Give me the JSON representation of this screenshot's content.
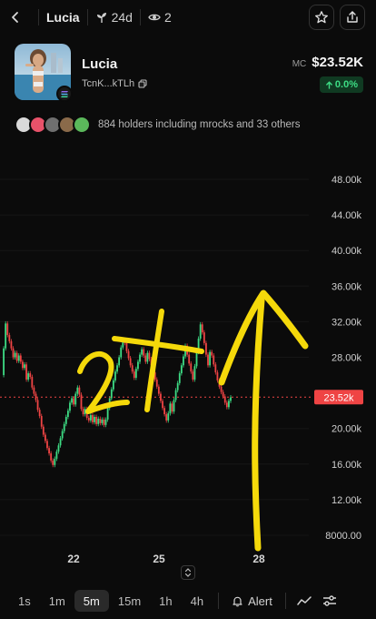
{
  "topbar": {
    "token_name": "Lucia",
    "age": "24d",
    "watchers": "2"
  },
  "token": {
    "name": "Lucia",
    "address": "TcnK...kTLh",
    "mc_label": "MC",
    "mc_value": "$23.52K",
    "change": "0.0%",
    "chain_icon": "solana-icon"
  },
  "holders": {
    "text": "884 holders including mrocks and 33 others"
  },
  "chart_data": {
    "type": "candlestick",
    "y_tick_labels": [
      "48.00k",
      "44.00k",
      "40.00k",
      "36.00k",
      "32.00k",
      "28.00k",
      "20.00k",
      "16.00k",
      "12.00k",
      "8000.00"
    ],
    "y_ticks": [
      48000,
      44000,
      40000,
      36000,
      32000,
      28000,
      20000,
      16000,
      12000,
      8000
    ],
    "ylim": [
      7000,
      50000
    ],
    "x_tick_labels": [
      "22",
      "25",
      "28"
    ],
    "current_price_label": "23.52k",
    "current_price": 23520,
    "colors": {
      "up": "#3ddc84",
      "down": "#ef4444",
      "price_line": "#ef4444",
      "annotation": "#f5d90a"
    },
    "series": [
      26000,
      29000,
      31800,
      30500,
      29800,
      29000,
      28000,
      28500,
      27600,
      28200,
      27500,
      26800,
      27200,
      25500,
      26200,
      25800,
      24600,
      23900,
      23200,
      22100,
      21400,
      20200,
      19300,
      18600,
      17800,
      17200,
      16400,
      15900,
      16600,
      17400,
      18100,
      18900,
      19700,
      20500,
      21300,
      22000,
      22900,
      23400,
      22700,
      23900,
      24600,
      23800,
      22200,
      21600,
      22200,
      21200,
      20900,
      21500,
      20700,
      21300,
      20500,
      21100,
      20600,
      21000,
      20400,
      21000,
      22300,
      23400,
      24400,
      25400,
      26400,
      27100,
      28000,
      29100,
      29900,
      29600,
      28700,
      27900,
      27100,
      26400,
      25700,
      26700,
      27500,
      28300,
      28900,
      28200,
      27500,
      28500,
      27800,
      27100,
      26300,
      25500,
      24700,
      23900,
      23100,
      22300,
      21600,
      20900,
      21700,
      22800,
      21900,
      23200,
      24300,
      25100,
      26200,
      27100,
      28100,
      29300,
      28300,
      27300,
      26400,
      25500,
      27000,
      28600,
      30100,
      31700,
      30800,
      29600,
      28300,
      27100,
      28600,
      28200,
      27200,
      26300,
      25400,
      24700,
      24100,
      23600,
      22900,
      22400,
      23100,
      23500
    ]
  },
  "bottombar": {
    "timeframes": [
      "1s",
      "1m",
      "5m",
      "15m",
      "1h",
      "4h"
    ],
    "active_timeframe": "5m",
    "alert_label": "Alert"
  }
}
